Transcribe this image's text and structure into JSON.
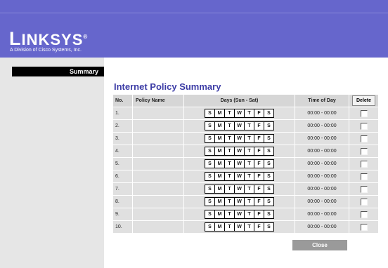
{
  "brand": {
    "logo_text_first": "L",
    "logo_text_rest": "INKSYS",
    "registered_mark": "®",
    "tagline": "A Division of Cisco Systems, Inc."
  },
  "sidebar": {
    "items": [
      {
        "label": "Summary"
      }
    ]
  },
  "page_title": "Internet Policy Summary",
  "table": {
    "headers": {
      "no": "No.",
      "policy_name": "Policy Name",
      "days": "Days (Sun - Sat)",
      "time": "Time of Day",
      "delete": "Delete"
    },
    "day_letters": [
      "S",
      "M",
      "T",
      "W",
      "T",
      "F",
      "S"
    ],
    "rows": [
      {
        "no": "1.",
        "policy_name": "",
        "time": "00:00 - 00:00",
        "delete_checked": false
      },
      {
        "no": "2.",
        "policy_name": "",
        "time": "00:00 - 00:00",
        "delete_checked": false
      },
      {
        "no": "3.",
        "policy_name": "",
        "time": "00:00 - 00:00",
        "delete_checked": false
      },
      {
        "no": "4.",
        "policy_name": "",
        "time": "00:00 - 00:00",
        "delete_checked": false
      },
      {
        "no": "5.",
        "policy_name": "",
        "time": "00:00 - 00:00",
        "delete_checked": false
      },
      {
        "no": "6.",
        "policy_name": "",
        "time": "00:00 - 00:00",
        "delete_checked": false
      },
      {
        "no": "7.",
        "policy_name": "",
        "time": "00:00 - 00:00",
        "delete_checked": false
      },
      {
        "no": "8.",
        "policy_name": "",
        "time": "00:00 - 00:00",
        "delete_checked": false
      },
      {
        "no": "9.",
        "policy_name": "",
        "time": "00:00 - 00:00",
        "delete_checked": false
      },
      {
        "no": "10.",
        "policy_name": "",
        "time": "00:00 - 00:00",
        "delete_checked": false
      }
    ]
  },
  "close_label": "Close",
  "colors": {
    "header": "#6666cc",
    "title": "#3d3da6",
    "sidebar": "#e6e6e6",
    "cell": "#e0e0e0",
    "close_button": "#9a9a9a"
  }
}
